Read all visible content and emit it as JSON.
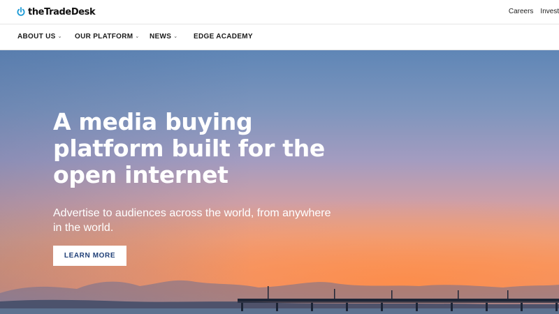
{
  "brand": {
    "name": "theTradeDesk",
    "accent": "#1a9ad6"
  },
  "utility": {
    "careers": "Careers",
    "investors": "Investors"
  },
  "nav": {
    "items": [
      {
        "label": "ABOUT US",
        "has_dropdown": true
      },
      {
        "label": "OUR PLATFORM",
        "has_dropdown": true
      },
      {
        "label": "NEWS",
        "has_dropdown": true
      },
      {
        "label": "EDGE ACADEMY",
        "has_dropdown": false
      }
    ]
  },
  "hero": {
    "title": "A media buying platform built for the open internet",
    "subtitle": "Advertise to audiences across the world, from anywhere in the world.",
    "cta_label": "LEARN MORE",
    "cta_color": "#1f3f77"
  }
}
